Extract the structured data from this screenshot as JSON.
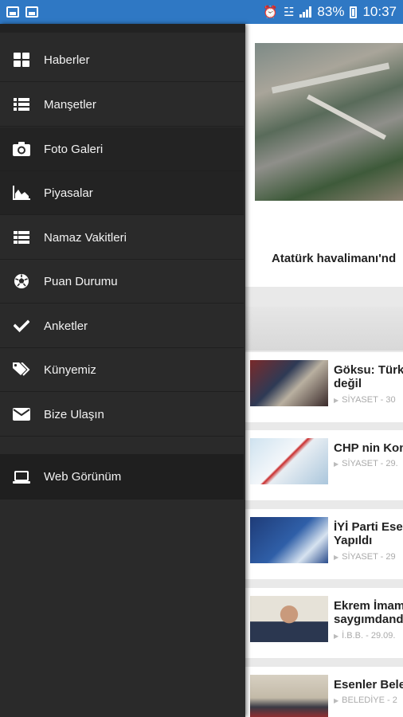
{
  "status_bar": {
    "battery": "83%",
    "time": "10:37",
    "icons": [
      "gallery-icon",
      "photo-icon",
      "alarm-icon",
      "wifi-icon",
      "signal-icon",
      "battery-icon"
    ]
  },
  "drawer": {
    "items": [
      {
        "label": "Haberler",
        "icon": "grid-icon"
      },
      {
        "label": "Manşetler",
        "icon": "list-icon"
      },
      {
        "label": "Foto Galeri",
        "icon": "camera-icon"
      },
      {
        "label": "Piyasalar",
        "icon": "area-chart-icon"
      },
      {
        "label": "Namaz Vakitleri",
        "icon": "table-list-icon"
      },
      {
        "label": "Puan Durumu",
        "icon": "soccer-ball-icon"
      },
      {
        "label": "Anketler",
        "icon": "check-icon"
      },
      {
        "label": "Künyemiz",
        "icon": "tags-icon"
      },
      {
        "label": "Bize Ulaşın",
        "icon": "envelope-icon"
      }
    ],
    "web_view": {
      "label": "Web Görünüm",
      "icon": "laptop-icon"
    }
  },
  "content": {
    "hero_title": "Atatürk havalimanı'nd",
    "news": [
      {
        "title_lines": [
          "Göksu: Türk",
          "değil"
        ],
        "meta": "SİYASET - 30"
      },
      {
        "title_lines": [
          "CHP nin Kon"
        ],
        "meta": "SİYASET - 29."
      },
      {
        "title_lines": [
          "İYİ Parti Ese",
          "Yapıldı"
        ],
        "meta": "SİYASET - 29"
      },
      {
        "title_lines": [
          "Ekrem İmam",
          "saygımdand"
        ],
        "meta": "İ.B.B. - 29.09."
      },
      {
        "title_lines": [
          "Esenler Bele"
        ],
        "meta": "BELEDİYE - 2"
      }
    ]
  }
}
